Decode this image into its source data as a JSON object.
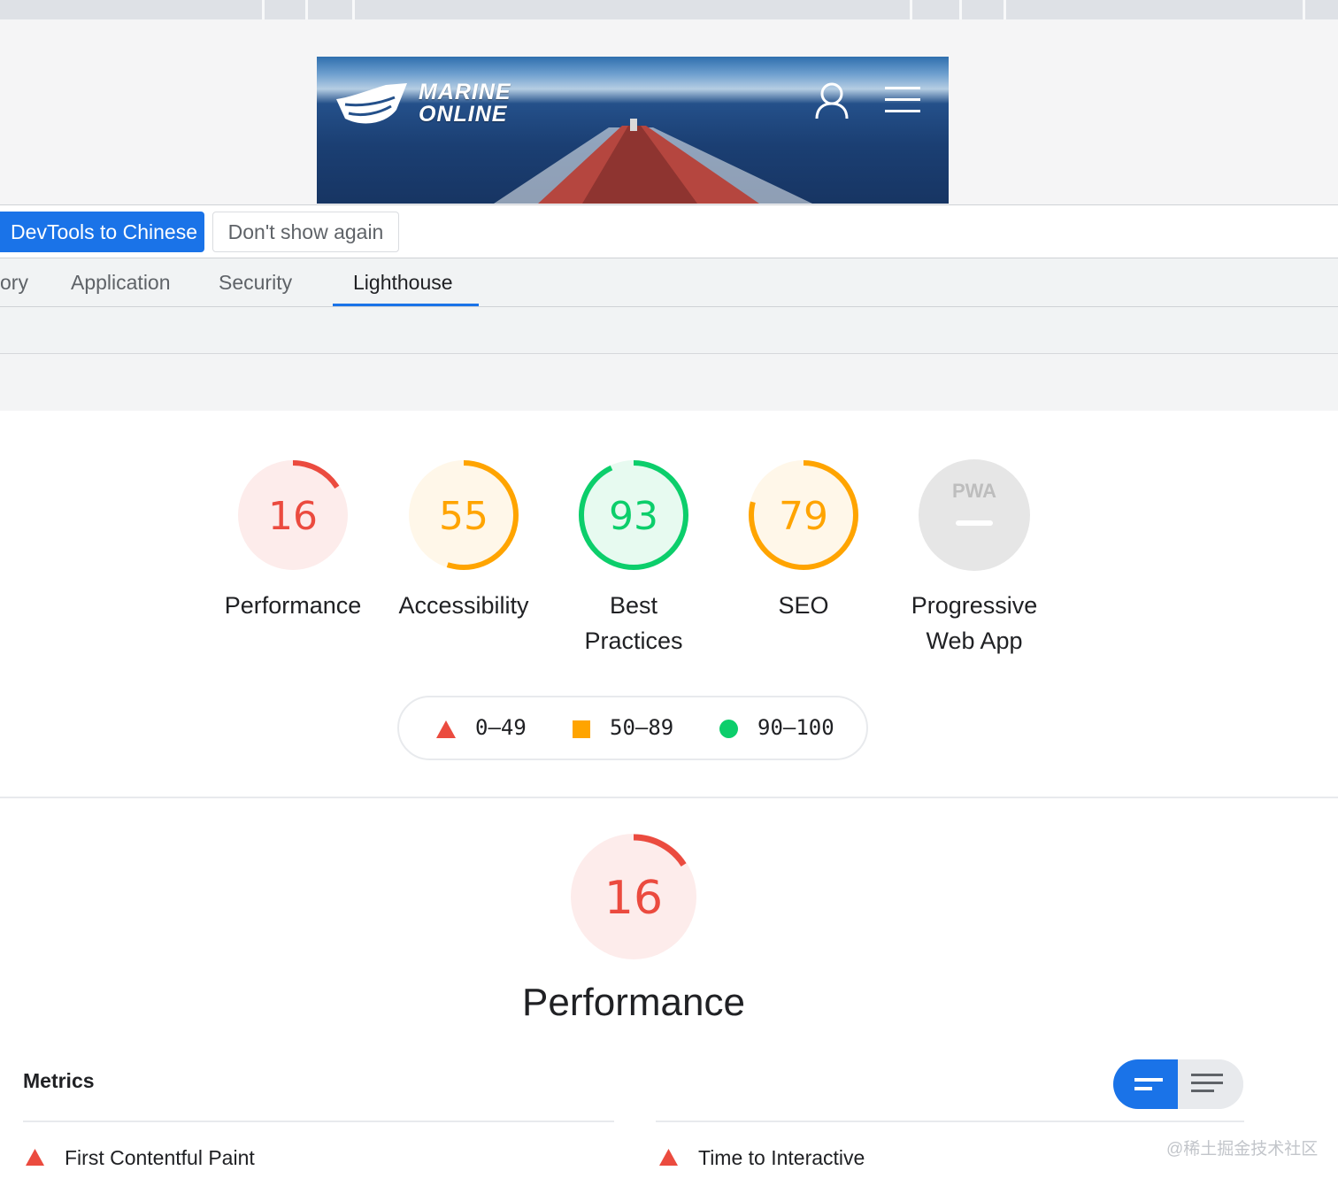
{
  "browser": {
    "hero": {
      "logo_line1": "MARINE",
      "logo_line2": "ONLINE",
      "logo_icon": "ship-logo-icon",
      "user_icon": "user-icon",
      "menu_icon": "hamburger-menu-icon"
    }
  },
  "devtools": {
    "infobar": {
      "switch_label": "DevTools to Chinese",
      "dismiss_label": "Don't show again"
    },
    "tabs": [
      {
        "label": "ory",
        "active": false
      },
      {
        "label": "Application",
        "active": false
      },
      {
        "label": "Security",
        "active": false
      },
      {
        "label": "Lighthouse",
        "active": true
      }
    ]
  },
  "lighthouse": {
    "categories": [
      {
        "name": "Performance",
        "score": 16,
        "status": "fail"
      },
      {
        "name": "Accessibility",
        "score": 55,
        "status": "average"
      },
      {
        "name": "Best Practices",
        "score": 93,
        "status": "pass"
      },
      {
        "name": "SEO",
        "score": 79,
        "status": "average"
      },
      {
        "name": "Progressive Web App",
        "score_text": "PWA",
        "status": "na"
      }
    ],
    "legend": [
      {
        "range": "0–49",
        "icon": "triangle-fail-icon",
        "color": "#eb4b3f"
      },
      {
        "range": "50–89",
        "icon": "square-average-icon",
        "color": "#ffa400"
      },
      {
        "range": "90–100",
        "icon": "circle-pass-icon",
        "color": "#0cce6b"
      }
    ],
    "section": {
      "score": 16,
      "title": "Performance"
    },
    "metrics": {
      "title": "Metrics",
      "items": [
        {
          "label": "First Contentful Paint",
          "status": "fail"
        },
        {
          "label": "Time to Interactive",
          "status": "fail"
        }
      ]
    },
    "colors": {
      "fail": "#eb4b3f",
      "fail_bg": "#fdeceb",
      "average": "#ffa400",
      "average_bg": "#fff7e9",
      "pass": "#0cce6b",
      "pass_bg": "#e7faf0",
      "pass_text": "#008800",
      "fail_text": "#cc0000",
      "average_text": "#c33300",
      "na": "#9e9e9e",
      "na_bg": "#e6e6e6"
    }
  },
  "watermark": "@稀土掘金技术社区"
}
